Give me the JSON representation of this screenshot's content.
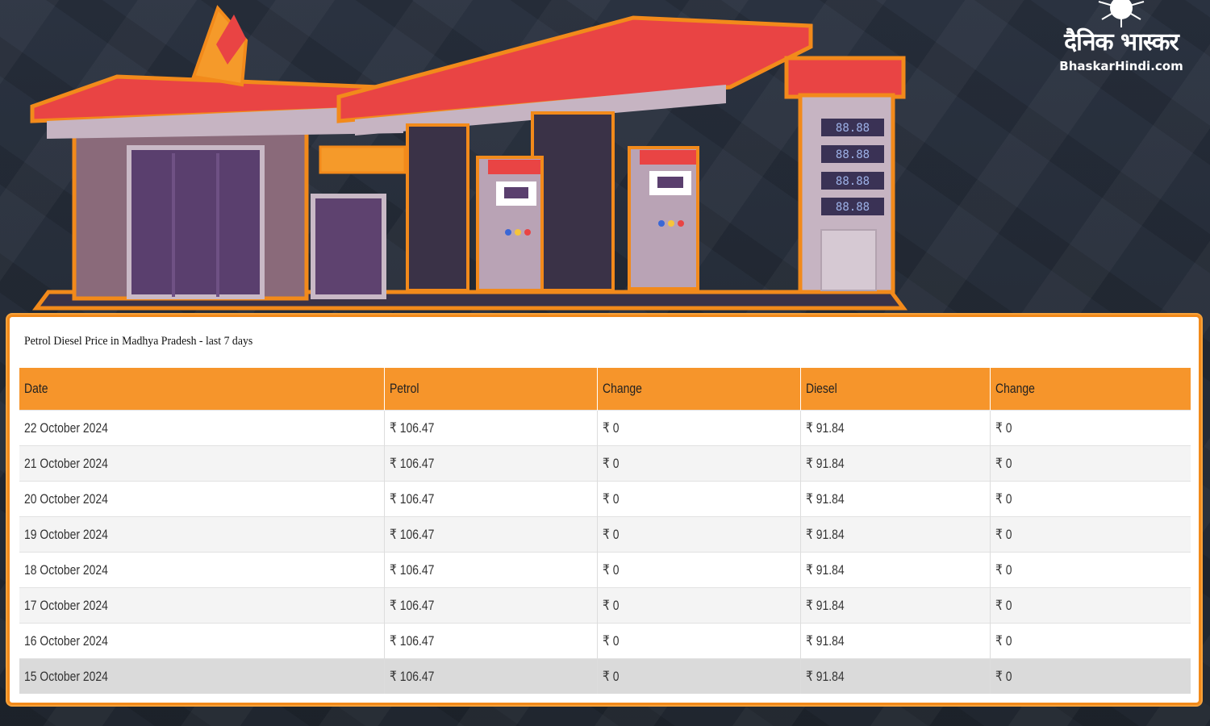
{
  "brand": {
    "name": "दैनिक भास्कर",
    "domain": "BhaskarHindi.com"
  },
  "illustration": {
    "pump_display_digits": [
      "88.88",
      "88.88",
      "88.88",
      "88.88"
    ]
  },
  "table": {
    "title": "Petrol Diesel Price in Madhya Pradesh - last 7 days",
    "headers": {
      "date": "Date",
      "petrol": "Petrol",
      "petrol_change": "Change",
      "diesel": "Diesel",
      "diesel_change": "Change"
    },
    "rows": [
      {
        "date": "22 October 2024",
        "petrol": "₹ 106.47",
        "petrol_change": "₹ 0",
        "diesel": "₹ 91.84",
        "diesel_change": "₹ 0"
      },
      {
        "date": "21 October 2024",
        "petrol": "₹ 106.47",
        "petrol_change": "₹ 0",
        "diesel": "₹ 91.84",
        "diesel_change": "₹ 0"
      },
      {
        "date": "20 October 2024",
        "petrol": "₹ 106.47",
        "petrol_change": "₹ 0",
        "diesel": "₹ 91.84",
        "diesel_change": "₹ 0"
      },
      {
        "date": "19 October 2024",
        "petrol": "₹ 106.47",
        "petrol_change": "₹ 0",
        "diesel": "₹ 91.84",
        "diesel_change": "₹ 0"
      },
      {
        "date": "18 October 2024",
        "petrol": "₹ 106.47",
        "petrol_change": "₹ 0",
        "diesel": "₹ 91.84",
        "diesel_change": "₹ 0"
      },
      {
        "date": "17 October 2024",
        "petrol": "₹ 106.47",
        "petrol_change": "₹ 0",
        "diesel": "₹ 91.84",
        "diesel_change": "₹ 0"
      },
      {
        "date": "16 October 2024",
        "petrol": "₹ 106.47",
        "petrol_change": "₹ 0",
        "diesel": "₹ 91.84",
        "diesel_change": "₹ 0"
      },
      {
        "date": "15 October 2024",
        "petrol": "₹ 106.47",
        "petrol_change": "₹ 0",
        "diesel": "₹ 91.84",
        "diesel_change": "₹ 0"
      }
    ]
  },
  "colors": {
    "accent_orange": "#f6952b",
    "canopy_red": "#ee3b3b",
    "background_dark": "#262d3a"
  }
}
